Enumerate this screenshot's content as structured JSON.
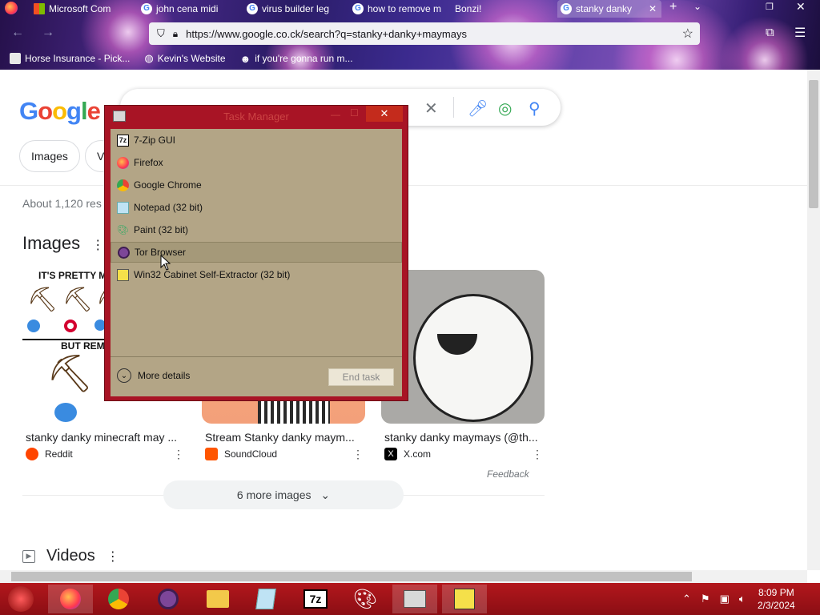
{
  "browser": {
    "tabs": [
      {
        "label": "Microsoft Com"
      },
      {
        "label": "john cena midi"
      },
      {
        "label": "virus builder leg"
      },
      {
        "label": "how to remove m"
      },
      {
        "label": "Bonzi!"
      },
      {
        "label": "stanky danky"
      }
    ],
    "url": "https://www.google.co.ck/search?q=stanky+danky+maymays",
    "bookmarks": [
      {
        "label": "Horse Insurance - Pick..."
      },
      {
        "label": "Kevin's Website"
      },
      {
        "label": "if you're gonna run m..."
      }
    ]
  },
  "google": {
    "logo": "Google",
    "chips": [
      "Images",
      "V"
    ],
    "result_count": "About 1,120 res",
    "images_heading": "Images",
    "image_results": [
      {
        "caption": "stanky danky minecraft may ...",
        "source": "Reddit",
        "thumb_text_1": "IT'S PRETTY MU",
        "thumb_text_2": "BUT REME"
      },
      {
        "caption": "Stream Stanky danky maym...",
        "source": "SoundCloud"
      },
      {
        "caption": "stanky danky maymays (@th...",
        "source": "X.com"
      }
    ],
    "feedback": "Feedback",
    "more_images": "6 more images",
    "videos_heading": "Videos"
  },
  "task_manager": {
    "title": "Task Manager",
    "apps": [
      {
        "label": "7-Zip GUI",
        "icon": "7z"
      },
      {
        "label": "Firefox",
        "icon": "firefox"
      },
      {
        "label": "Google Chrome",
        "icon": "chrome"
      },
      {
        "label": "Notepad (32 bit)",
        "icon": "notepad"
      },
      {
        "label": "Paint (32 bit)",
        "icon": "paint"
      },
      {
        "label": "Tor Browser",
        "icon": "tor"
      },
      {
        "label": "Win32 Cabinet Self-Extractor (32 bit)",
        "icon": "installer"
      }
    ],
    "selected_index": 5,
    "more_details": "More details",
    "end_task": "End task"
  },
  "taskbar": {
    "clock_time": "8:09 PM",
    "clock_date": "2/3/2024"
  },
  "colors": {
    "taskbar": "#a3121a",
    "taskmgr_frame": "#a81425",
    "taskmgr_body": "#b3a586"
  }
}
